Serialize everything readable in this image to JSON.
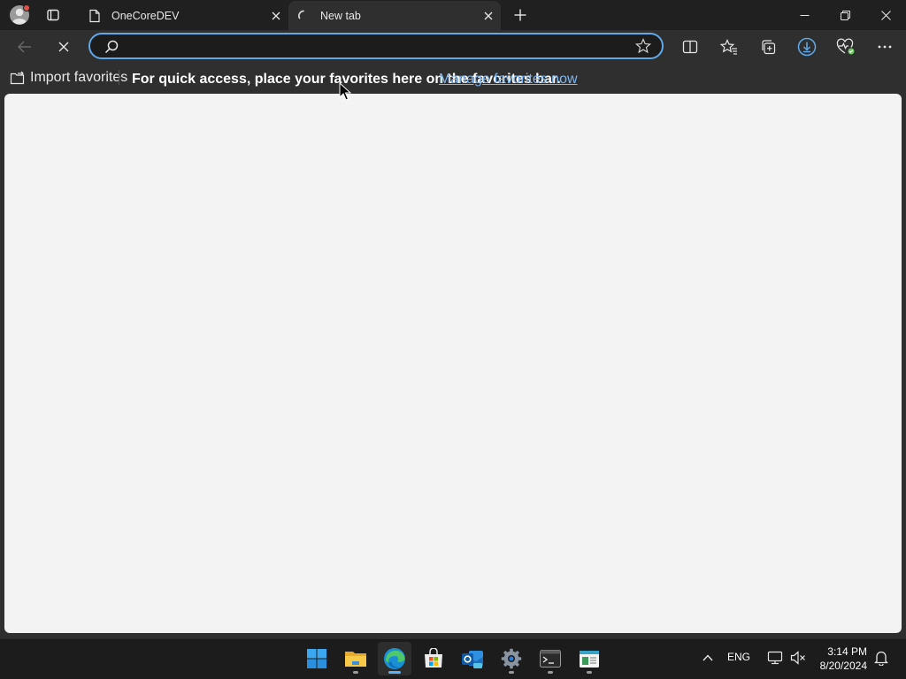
{
  "tabs": [
    {
      "label": "OneCoreDEV",
      "active": false
    },
    {
      "label": "New tab",
      "active": true
    }
  ],
  "omnibox": {
    "placeholder": "",
    "value": ""
  },
  "favorites_bar": {
    "import_label": "Import favorites",
    "message": "For quick access, place your favorites here on the favorites bar.",
    "link_label": "Manage favorites now"
  },
  "taskbar": {
    "apps": [
      "start-icon",
      "file-explorer-icon",
      "edge-icon",
      "microsoft-store-icon",
      "outlook-icon",
      "settings-icon",
      "terminal-icon",
      "notepad-icon"
    ],
    "language": "ENG",
    "time": "3:14 PM",
    "date": "8/20/2024"
  },
  "colors": {
    "accent": "#5fa8e9",
    "link": "#7db7f5",
    "chrome_bg": "#202020",
    "toolbar_bg": "#2f2f2f",
    "page_bg": "#f3f3f3"
  }
}
